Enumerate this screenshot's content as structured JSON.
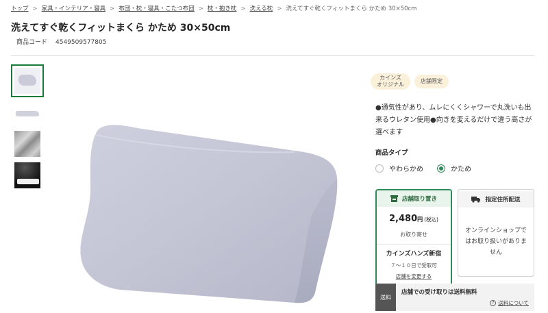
{
  "breadcrumb": [
    "トップ",
    "家具・インテリア・寝具",
    "布団・枕・寝具・こたつ布団",
    "枕・抱き枕",
    "洗える枕",
    "洗えてすぐ乾くフィットまくら かため 30×50cm"
  ],
  "breadcrumb_sep": ">",
  "product": {
    "title": "洗えてすぐ乾くフィットまくら かため 30×50cm",
    "code_label": "商品コード",
    "code_value": "4549509577805"
  },
  "badges": [
    "カインズ\nオリジナル",
    "店舗限定"
  ],
  "description": "●通気性があり、ムレにくくシャワーで丸洗いも出来るウレタン使用●向きを変えるだけで違う高さが選べます",
  "product_type": {
    "label": "商品タイプ",
    "options": [
      "やわらかめ",
      "かため"
    ],
    "selected": "かため"
  },
  "store_pickup": {
    "header": "店舗取り置き",
    "price": "2,480",
    "yen": "円",
    "tax": "(税込)",
    "order_note": "お取り寄せ",
    "store_name": "カインズハンズ新宿",
    "receive": "７～１０日で受取可",
    "change_store": "店舗を変更する"
  },
  "home_delivery": {
    "header": "指定住所配送",
    "message": "オンラインショップではお取り扱いがありません"
  },
  "shipping_bar": {
    "tag": "送料",
    "message": "店舗での受け取りは送料無料",
    "link": "送料について"
  },
  "colors": {
    "accent_green": "#2e8b57",
    "badge_bg": "#fbf0da"
  }
}
